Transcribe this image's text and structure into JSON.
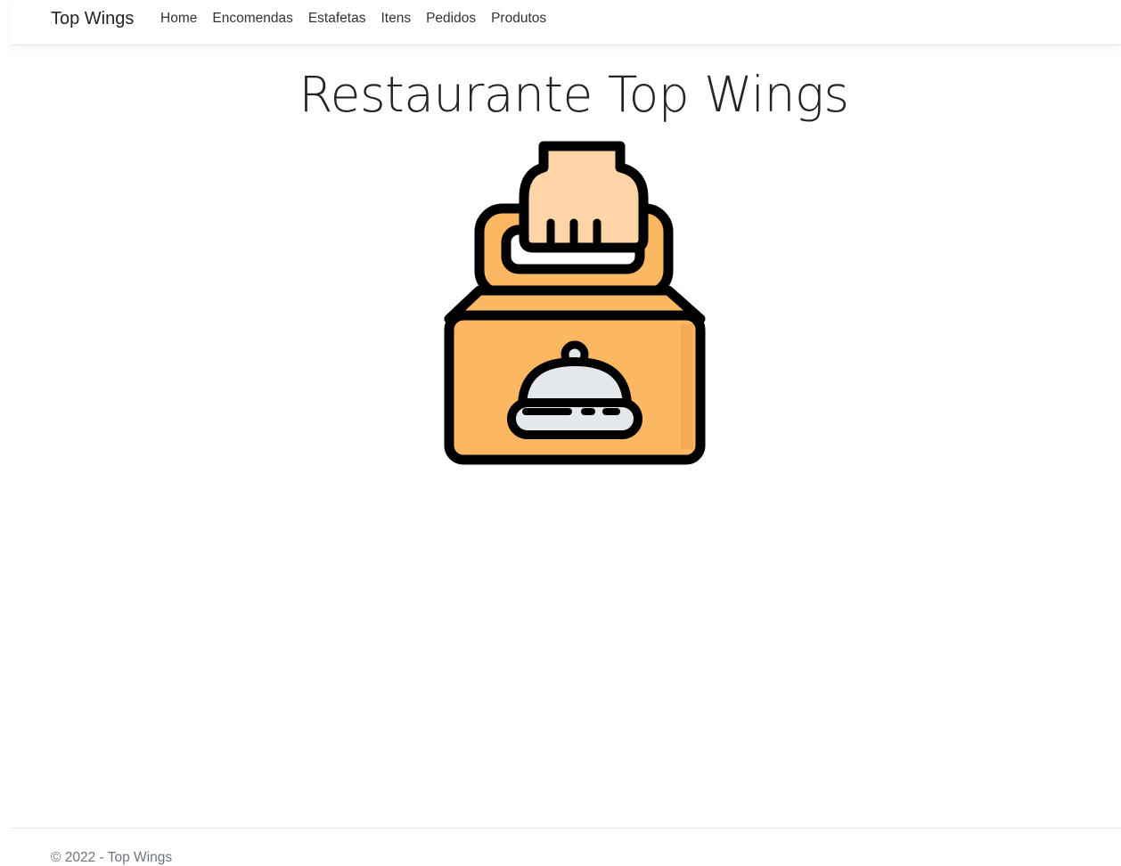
{
  "navbar": {
    "brand": "Top Wings",
    "links": [
      {
        "label": "Home"
      },
      {
        "label": "Encomendas"
      },
      {
        "label": "Estafetas"
      },
      {
        "label": "Itens"
      },
      {
        "label": "Pedidos"
      },
      {
        "label": "Produtos"
      }
    ]
  },
  "main": {
    "title": "Restaurante Top Wings",
    "logo_icon": "takeaway-box-cloche-icon"
  },
  "footer": {
    "text": "© 2022 - Top Wings"
  },
  "colors": {
    "box": "#FBB762",
    "box_shade": "#F5A955",
    "hand": "#FFD5A8",
    "cloche": "#E4E7EB",
    "outline": "#000000"
  }
}
